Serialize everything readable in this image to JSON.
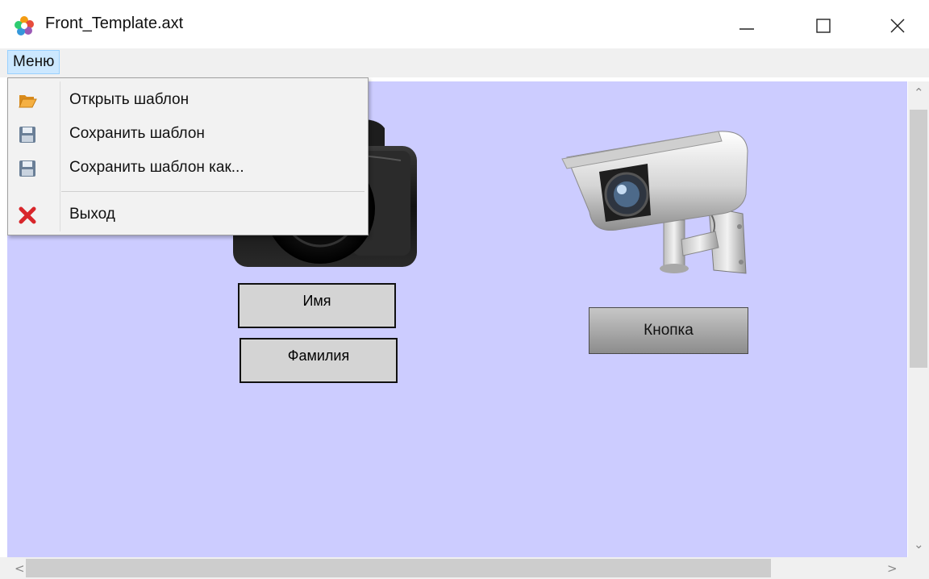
{
  "window": {
    "title": "Front_Template.axt",
    "controls": {
      "minimize_icon": "minimize-icon",
      "maximize_icon": "maximize-icon",
      "close_icon": "close-icon"
    }
  },
  "menubar": {
    "root_label": "Меню",
    "items": [
      {
        "label": "Открыть шаблон",
        "icon": "folder-open-icon"
      },
      {
        "label": "Сохранить шаблон",
        "icon": "floppy-save-icon"
      },
      {
        "label": "Сохранить шаблон как...",
        "icon": "floppy-save-as-icon"
      },
      {
        "label": "Выход",
        "icon": "red-x-exit-icon"
      }
    ]
  },
  "canvas": {
    "background": "#ccccff",
    "fields": {
      "name_label": "Имя",
      "surname_label": "Фамилия"
    },
    "button_label": "Кнопка",
    "images": [
      "photo-camera-icon",
      "cctv-camera-icon"
    ]
  },
  "scrollbars": {
    "vertical": true,
    "horizontal": true
  }
}
